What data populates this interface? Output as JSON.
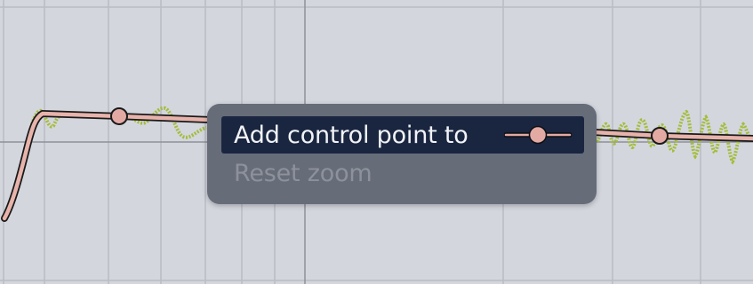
{
  "colors": {
    "background": "#d4d6de",
    "grid_line": "#b9bcc4",
    "axis_line": "#8e9199",
    "curve_stroke": "#1a1a1a",
    "curve_fill": "#e7b3ab",
    "control_point": "#e3aaa3",
    "waveform": "#a4bd3a",
    "menu_background": "#676c79",
    "menu_highlight": "#1a2640",
    "menu_text": "#f1f3f7",
    "menu_text_disabled": "#8d919b"
  },
  "context_menu": {
    "items": [
      {
        "label": "Add control point to",
        "icon": "control-point-icon",
        "enabled": true,
        "highlighted": true
      },
      {
        "label": "Reset zoom",
        "enabled": false,
        "highlighted": false
      }
    ]
  }
}
